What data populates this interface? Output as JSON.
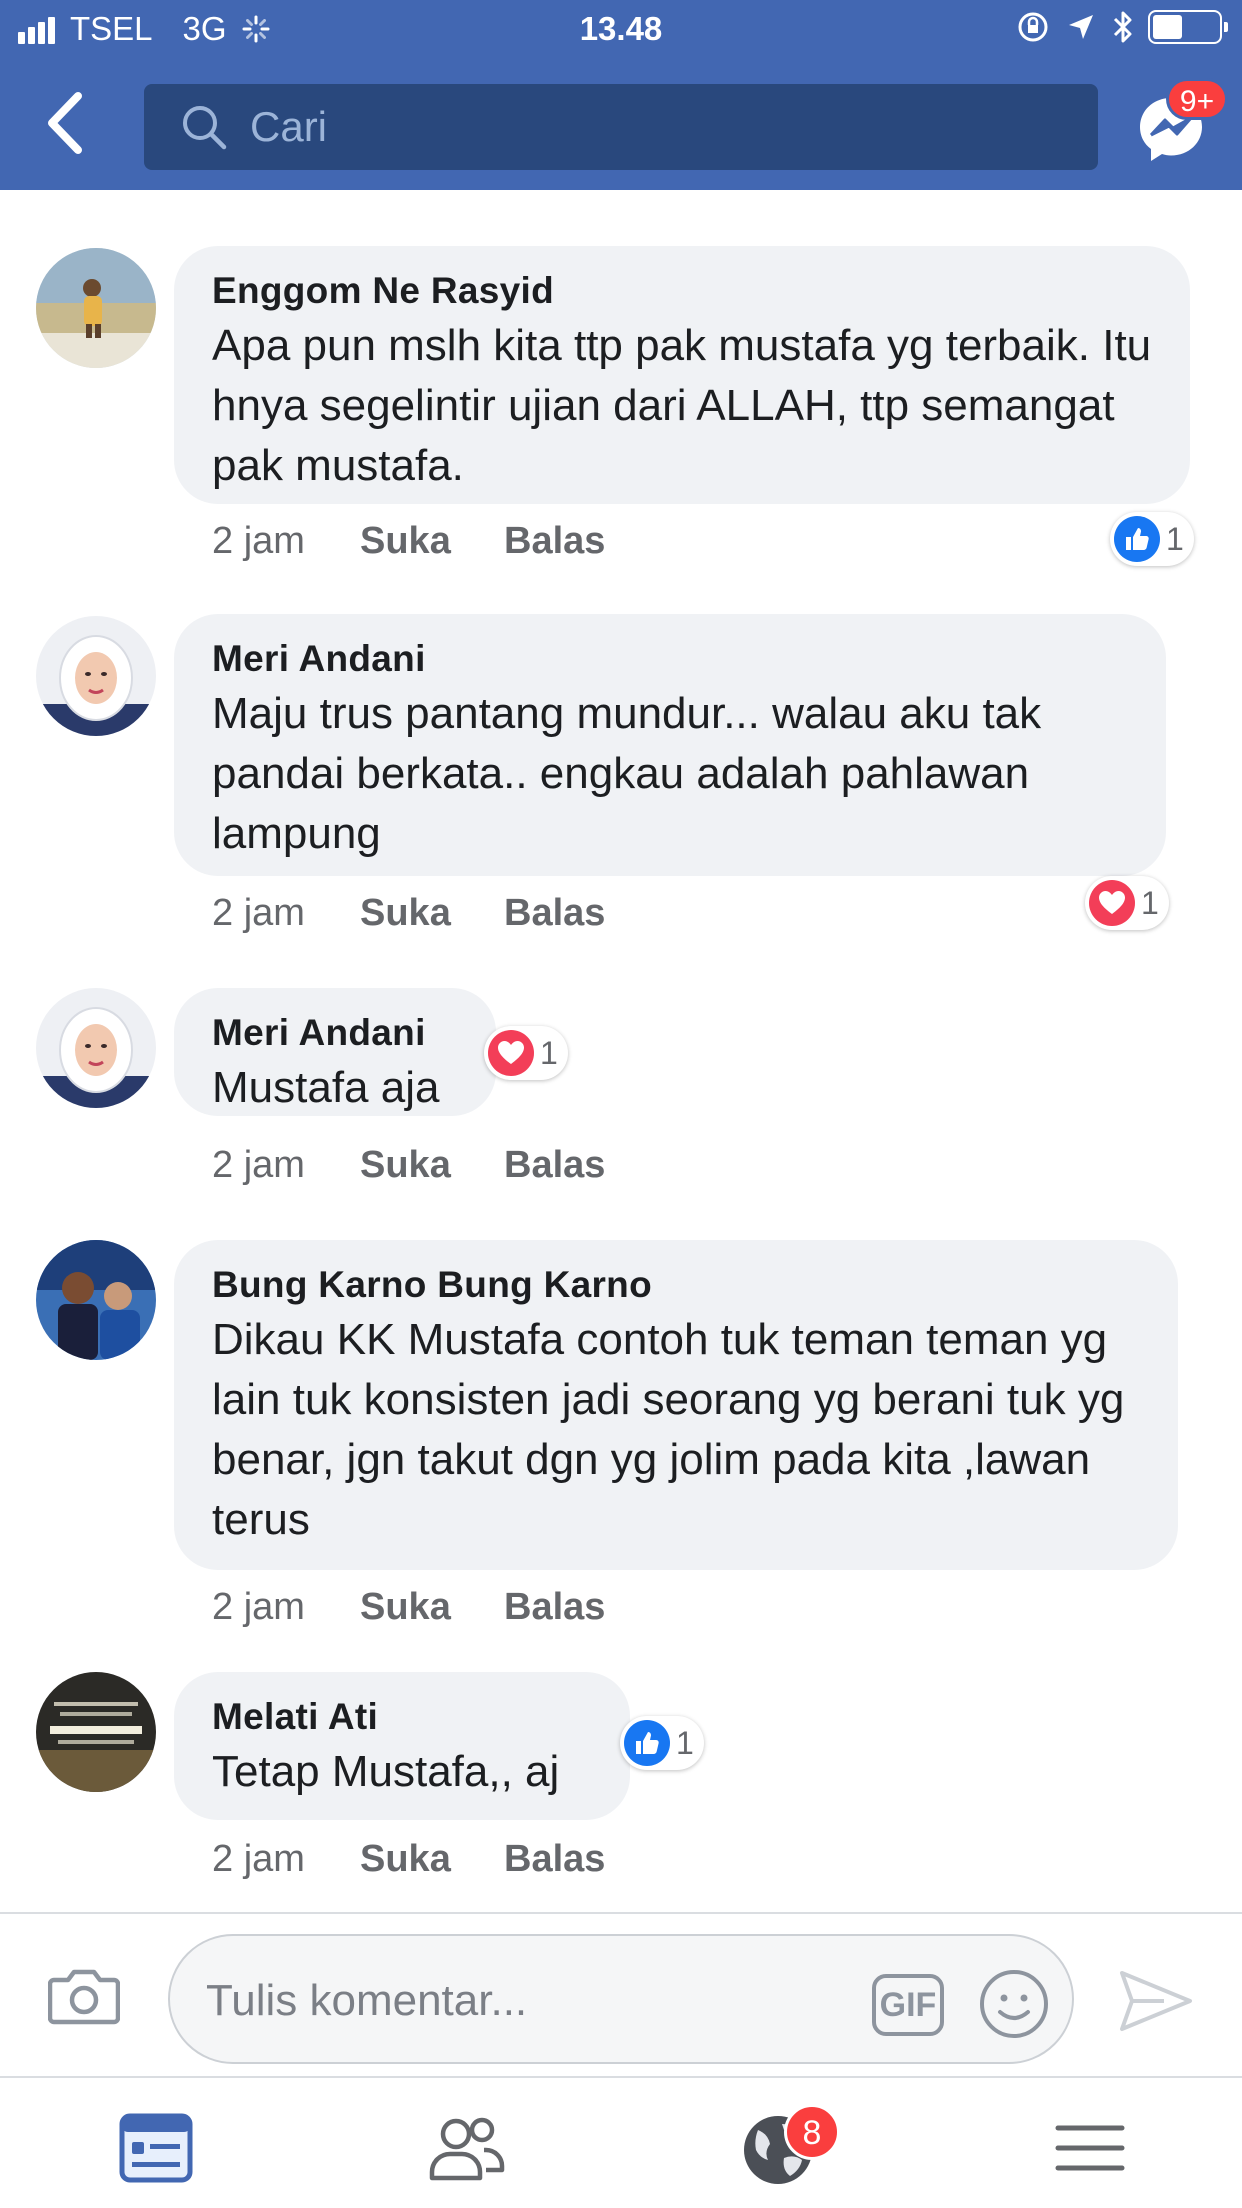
{
  "status_bar": {
    "carrier": "TSEL",
    "network": "3G",
    "time": "13.48",
    "battery_level": 0.45
  },
  "header": {
    "search_placeholder": "Cari",
    "messenger_badge": "9+"
  },
  "comments": [
    {
      "name": "Enggom Ne Rasyid",
      "text": "Apa pun mslh kita ttp pak mustafa yg terbaik. Itu hnya segelintir ujian dari ALLAH, ttp semangat pak mustafa.",
      "time": "2 jam",
      "like_label": "Suka",
      "reply_label": "Balas",
      "reaction": {
        "type": "like",
        "count": "1"
      }
    },
    {
      "name": "Meri Andani",
      "text": "Maju trus pantang mundur... walau aku tak pandai berkata.. engkau adalah pahlawan lampung",
      "time": "2 jam",
      "like_label": "Suka",
      "reply_label": "Balas",
      "reaction": {
        "type": "love",
        "count": "1"
      }
    },
    {
      "name": "Meri Andani",
      "text": "Mustafa aja",
      "time": "2 jam",
      "like_label": "Suka",
      "reply_label": "Balas",
      "reaction": {
        "type": "love",
        "count": "1"
      }
    },
    {
      "name": "Bung Karno Bung Karno",
      "text": "Dikau KK Mustafa contoh tuk teman teman yg lain tuk konsisten jadi seorang yg berani tuk yg benar, jgn takut dgn yg jolim pada kita ,lawan terus",
      "time": "2 jam",
      "like_label": "Suka",
      "reply_label": "Balas",
      "reaction": null
    },
    {
      "name": "Melati Ati",
      "text": "Tetap Mustafa,, aj",
      "time": "2 jam",
      "like_label": "Suka",
      "reply_label": "Balas",
      "reaction": {
        "type": "like",
        "count": "1"
      }
    }
  ],
  "composer": {
    "placeholder": "Tulis komentar...",
    "gif_label": "GIF"
  },
  "tabbar": {
    "notifications_badge": "8"
  },
  "colors": {
    "brand": "#4267b2",
    "search_bg": "#29487d",
    "badge": "#fa3e3e",
    "like": "#1877f2",
    "love": "#f33e58",
    "bubble": "#f0f2f5"
  },
  "icons": [
    "signal-icon",
    "loading-icon",
    "lock-rotation-icon",
    "location-icon",
    "bluetooth-icon",
    "battery-icon",
    "back-icon",
    "search-icon",
    "messenger-icon",
    "like-icon",
    "love-icon",
    "camera-icon",
    "emoji-icon",
    "send-icon",
    "news-feed-icon",
    "friends-icon",
    "notifications-globe-icon",
    "menu-icon"
  ]
}
